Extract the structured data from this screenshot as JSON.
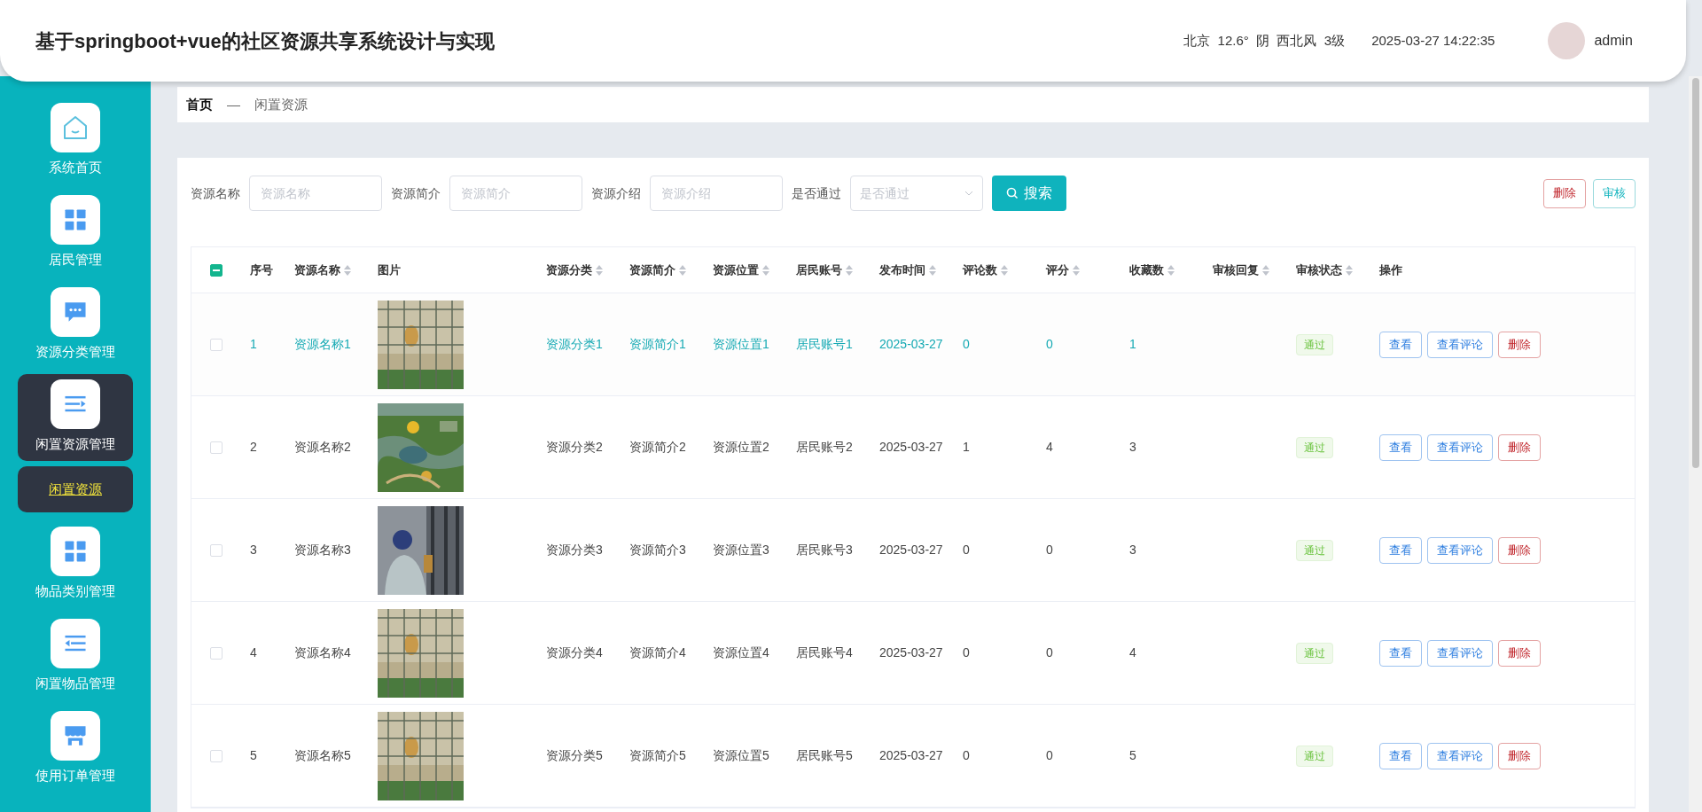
{
  "header": {
    "title": "基于springboot+vue的社区资源共享系统设计与实现",
    "weather": "北京  12.6°  阴  西北风  3级",
    "datetime": "2025-03-27 14:22:35",
    "user": "admin"
  },
  "sidebar": {
    "items": [
      {
        "label": "系统首页",
        "kind": "home",
        "selected": false
      },
      {
        "label": "居民管理",
        "kind": "grid",
        "selected": false
      },
      {
        "label": "资源分类管理",
        "kind": "chat",
        "selected": false
      },
      {
        "label": "闲置资源管理",
        "kind": "list",
        "selected": true,
        "children": [
          {
            "label": "闲置资源",
            "selected": true
          }
        ]
      },
      {
        "label": "物品类别管理",
        "kind": "grid",
        "selected": false
      },
      {
        "label": "闲置物品管理",
        "kind": "outdent",
        "selected": false
      },
      {
        "label": "使用订单管理",
        "kind": "shop",
        "selected": false
      }
    ]
  },
  "breadcrumb": [
    "首页",
    "—",
    "闲置资源"
  ],
  "filters": [
    {
      "label": "资源名称",
      "placeholder": "资源名称",
      "kind": "input"
    },
    {
      "label": "资源简介",
      "placeholder": "资源简介",
      "kind": "input"
    },
    {
      "label": "资源介绍",
      "placeholder": "资源介绍",
      "kind": "input"
    },
    {
      "label": "是否通过",
      "placeholder": "是否通过",
      "kind": "select"
    }
  ],
  "search_button": "搜索",
  "actions": [
    {
      "label": "删除",
      "kind": "danger"
    },
    {
      "label": "审核",
      "kind": "primary"
    }
  ],
  "table": {
    "select_all": {
      "indeterminate": true
    },
    "columns": [
      {
        "label": "序号",
        "sortable": false
      },
      {
        "label": "资源名称",
        "sortable": true
      },
      {
        "label": "图片",
        "sortable": false
      },
      {
        "label": "资源分类",
        "sortable": true
      },
      {
        "label": "资源简介",
        "sortable": true
      },
      {
        "label": "资源位置",
        "sortable": true
      },
      {
        "label": "居民账号",
        "sortable": true
      },
      {
        "label": "发布时间",
        "sortable": true
      },
      {
        "label": "评论数",
        "sortable": true
      },
      {
        "label": "评分",
        "sortable": true
      },
      {
        "label": "收藏数",
        "sortable": true
      },
      {
        "label": "审核回复",
        "sortable": true
      },
      {
        "label": "审核状态",
        "sortable": true
      },
      {
        "label": "操作",
        "sortable": false
      }
    ],
    "rows": [
      {
        "hovered": true,
        "checked": false,
        "cells": [
          "1",
          "资源名称1",
          {
            "kind": "picture"
          },
          "资源分类1",
          "资源简介1",
          "资源位置1",
          "居民账号1",
          "2025-03-27",
          "0",
          "0",
          "1",
          "",
          {
            "kind": "tag",
            "label": "通过"
          },
          {
            "kind": "buttons",
            "buttons": [
              {
                "label": "查看",
                "kind": "primary"
              },
              {
                "label": "查看评论",
                "kind": "primary"
              },
              {
                "label": "删除",
                "kind": "danger"
              }
            ]
          }
        ]
      },
      {
        "hovered": false,
        "checked": false,
        "cells": [
          "2",
          "资源名称2",
          {
            "kind": "picture"
          },
          "资源分类2",
          "资源简介2",
          "资源位置2",
          "居民账号2",
          "2025-03-27",
          "1",
          "4",
          "3",
          "",
          {
            "kind": "tag",
            "label": "通过"
          },
          {
            "kind": "buttons",
            "buttons": [
              {
                "label": "查看",
                "kind": "primary"
              },
              {
                "label": "查看评论",
                "kind": "primary"
              },
              {
                "label": "删除",
                "kind": "danger"
              }
            ]
          }
        ]
      },
      {
        "hovered": false,
        "checked": false,
        "cells": [
          "3",
          "资源名称3",
          {
            "kind": "picture"
          },
          "资源分类3",
          "资源简介3",
          "资源位置3",
          "居民账号3",
          "2025-03-27",
          "0",
          "0",
          "3",
          "",
          {
            "kind": "tag",
            "label": "通过"
          },
          {
            "kind": "buttons",
            "buttons": [
              {
                "label": "查看",
                "kind": "primary"
              },
              {
                "label": "查看评论",
                "kind": "primary"
              },
              {
                "label": "删除",
                "kind": "danger"
              }
            ]
          }
        ]
      },
      {
        "hovered": false,
        "checked": false,
        "cells": [
          "4",
          "资源名称4",
          {
            "kind": "picture"
          },
          "资源分类4",
          "资源简介4",
          "资源位置4",
          "居民账号4",
          "2025-03-27",
          "0",
          "0",
          "4",
          "",
          {
            "kind": "tag",
            "label": "通过"
          },
          {
            "kind": "buttons",
            "buttons": [
              {
                "label": "查看",
                "kind": "primary"
              },
              {
                "label": "查看评论",
                "kind": "primary"
              },
              {
                "label": "删除",
                "kind": "danger"
              }
            ]
          }
        ]
      },
      {
        "hovered": false,
        "checked": false,
        "cells": [
          "5",
          "资源名称5",
          {
            "kind": "picture"
          },
          "资源分类5",
          "资源简介5",
          "资源位置5",
          "居民账号5",
          "2025-03-27",
          "0",
          "0",
          "5",
          "",
          {
            "kind": "tag",
            "label": "通过"
          },
          {
            "kind": "buttons",
            "buttons": [
              {
                "label": "查看",
                "kind": "primary"
              },
              {
                "label": "查看评论",
                "kind": "primary"
              },
              {
                "label": "删除",
                "kind": "danger"
              }
            ]
          }
        ]
      }
    ]
  }
}
